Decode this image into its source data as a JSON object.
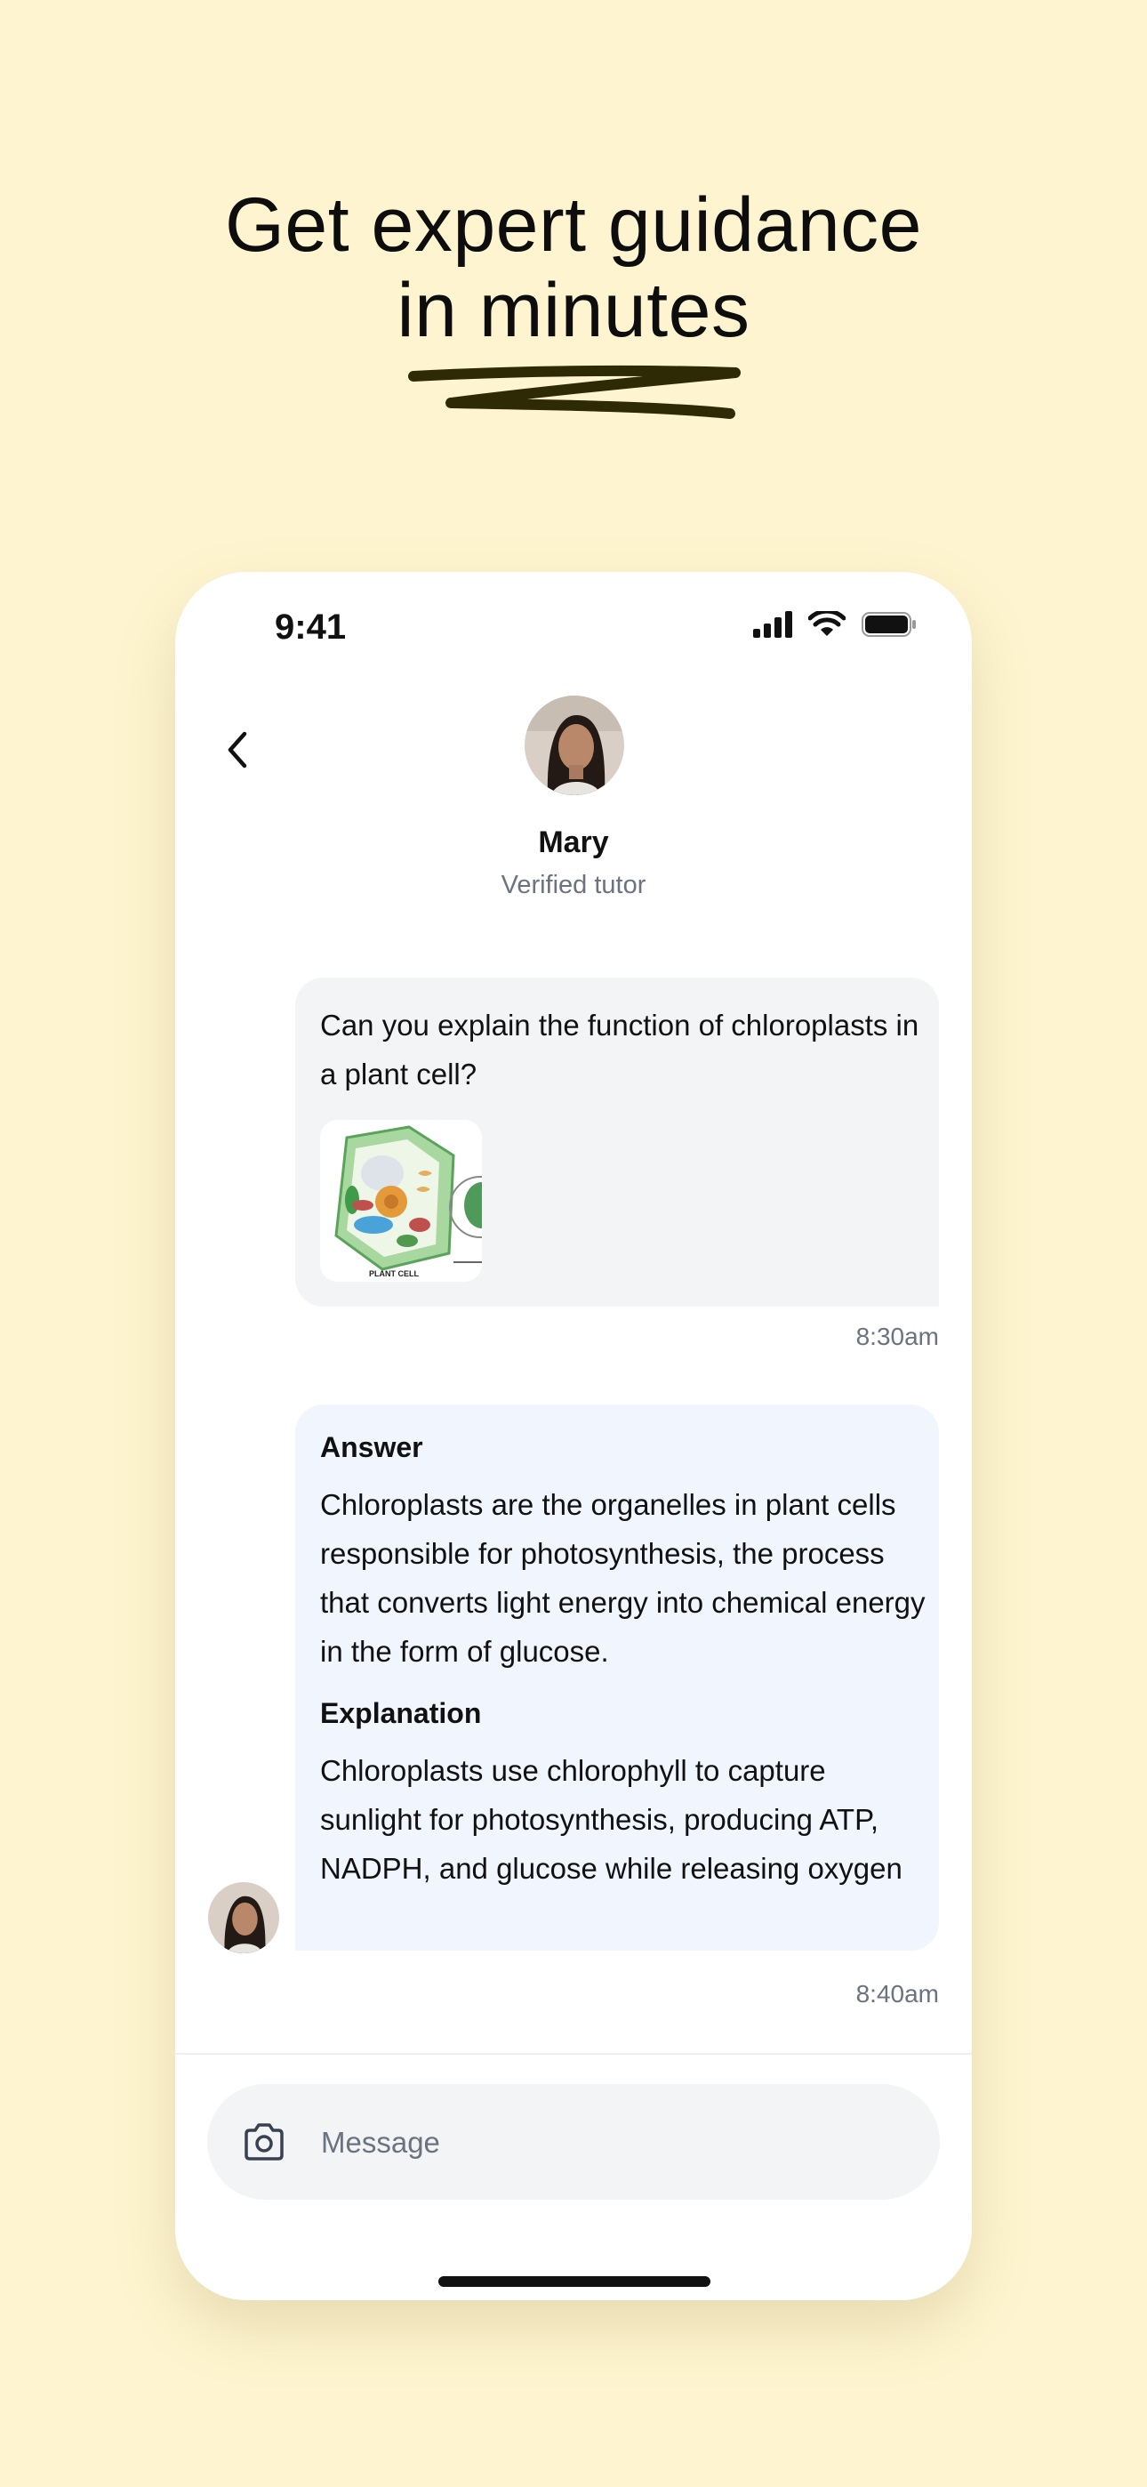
{
  "headline": {
    "line1": "Get expert guidance",
    "line2": "in minutes"
  },
  "status_bar": {
    "time": "9:41",
    "icons": [
      "cellular-signal-icon",
      "wifi-icon",
      "battery-icon"
    ]
  },
  "header": {
    "back_icon": "chevron-left-icon",
    "tutor_name": "Mary",
    "tutor_role": "Verified tutor"
  },
  "messages": [
    {
      "sender": "user",
      "text": "Can you explain the function of chloroplasts in a plant cell?",
      "attachment_caption": "PLANT CELL",
      "time": "8:30am"
    },
    {
      "sender": "tutor",
      "answer_heading": "Answer",
      "answer_text": "Chloroplasts are the organelles in plant cells responsible for photosynthesis, the process that converts light energy into chemical energy in the form of glucose.",
      "explanation_heading": "Explanation",
      "explanation_text": "Chloroplasts use chlorophyll to capture sunlight for photosynthesis, producing ATP, NADPH, and glucose while releasing oxygen",
      "time": "8:40am"
    }
  ],
  "composer": {
    "placeholder": "Message",
    "camera_icon": "camera-icon"
  },
  "colors": {
    "background": "#FEF5D0",
    "user_bubble": "#f3f4f6",
    "tutor_bubble": "#f1f5fe",
    "muted_text": "#6b7280"
  }
}
